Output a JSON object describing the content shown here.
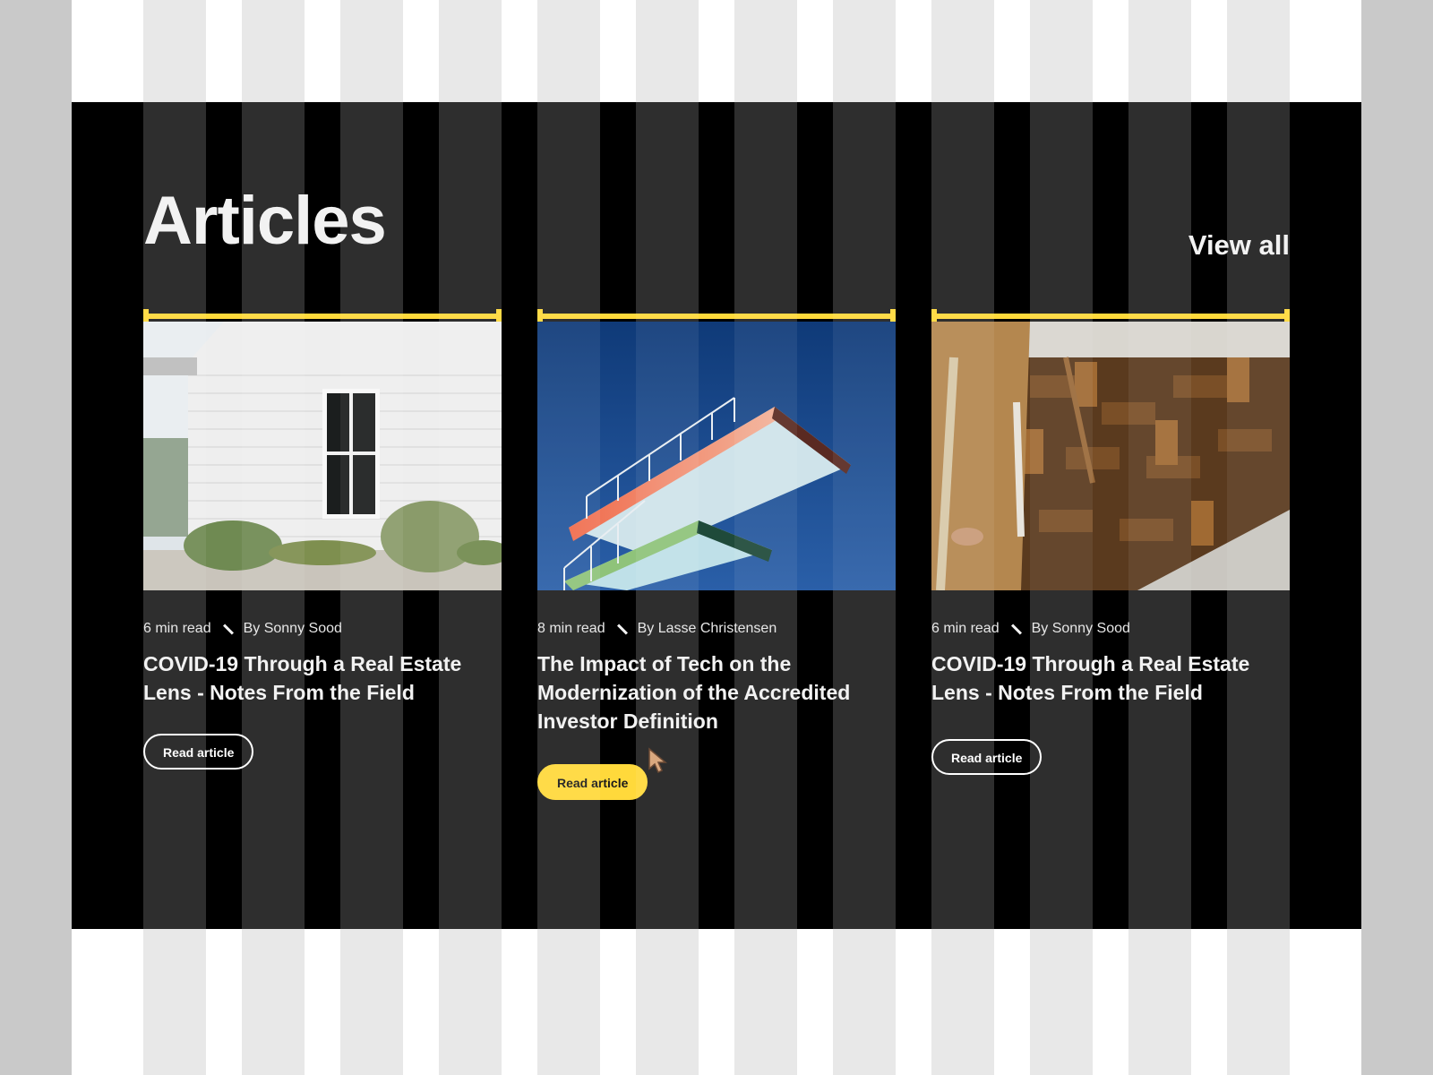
{
  "section": {
    "title": "Articles",
    "view_all": "View all"
  },
  "colors": {
    "accent": "#ffd93b",
    "background": "#000000",
    "text": "#f2f2f2"
  },
  "articles": [
    {
      "read_time": "6 min read",
      "author": "By Sonny Sood",
      "title": "COVID-19 Through a Real Estate Lens - Notes From the Field",
      "button": "Read article",
      "image": "white-house-photo"
    },
    {
      "read_time": "8 min read",
      "author": "By Lasse Christensen",
      "title": "The Impact of Tech on the Modernization of the Accredited Investor Definition",
      "button": "Read article",
      "image": "diving-platform-photo"
    },
    {
      "read_time": "6 min read",
      "author": "By Sonny Sood",
      "title": "COVID-19 Through a Real Estate Lens - Notes From the Field",
      "button": "Read article",
      "image": "parquet-floor-photo"
    }
  ]
}
